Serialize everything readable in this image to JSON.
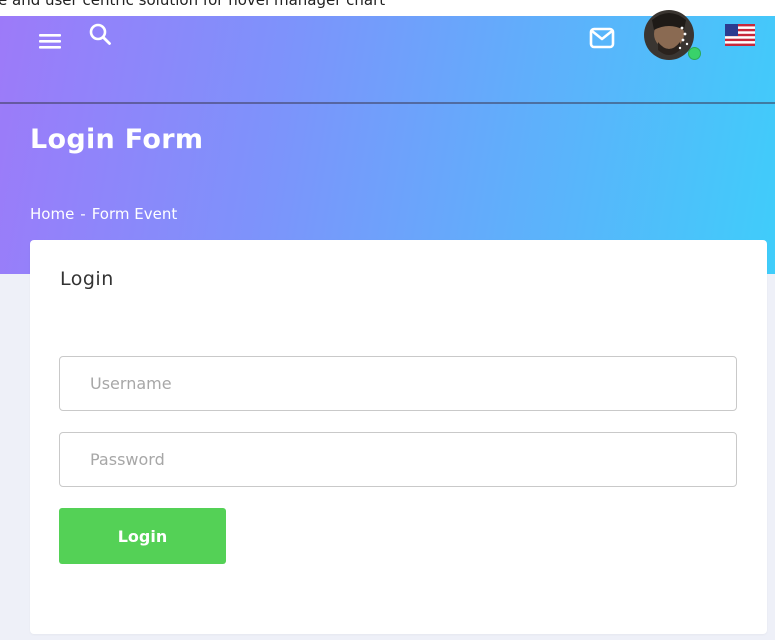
{
  "top_fragment": "e and user centric solution for novel manager chart",
  "header": {
    "icons": {
      "menu": "menu-icon",
      "search": "search-icon",
      "mail": "mail-icon",
      "avatar": "avatar",
      "flag": "flag-icon"
    }
  },
  "page": {
    "title": "Login Form",
    "breadcrumb": {
      "home": "Home",
      "separator": "-",
      "current": "Form Event"
    }
  },
  "card": {
    "title": "Login",
    "username_placeholder": "Username",
    "username_value": "",
    "password_placeholder": "Password",
    "password_value": "",
    "login_label": "Login"
  },
  "colors": {
    "gradient_start": "#9d7af9",
    "gradient_end": "#3fcdfa",
    "button": "#54d156",
    "status_online": "#39d26a"
  }
}
